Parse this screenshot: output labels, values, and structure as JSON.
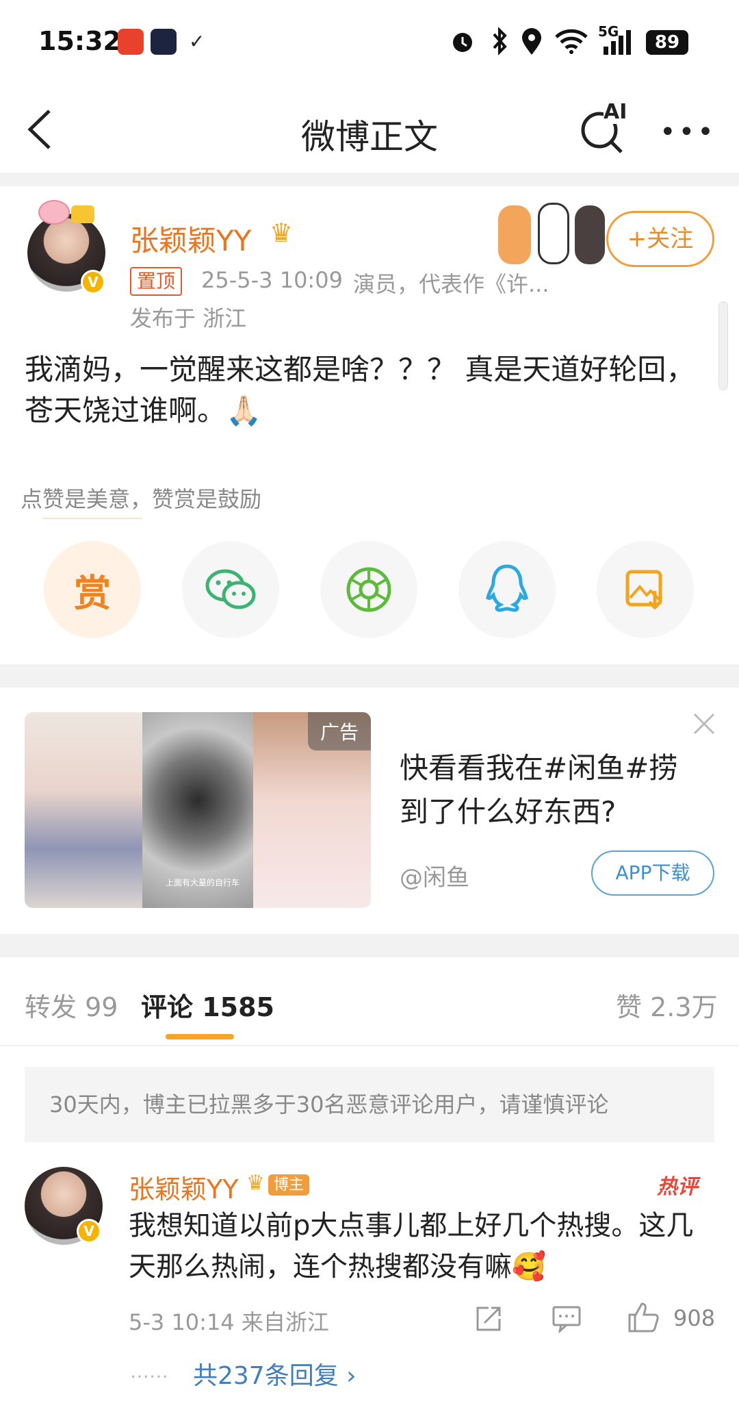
{
  "status_bar": {
    "time": "15:32",
    "signal": "5G",
    "battery": "89"
  },
  "nav": {
    "title": "微博正文",
    "ai_label": "AI"
  },
  "post": {
    "author": "张颖颖YY",
    "pin_label": "置顶",
    "date": "25-5-3 10:09",
    "bio": "演员，代表作《许...",
    "location": "发布于 浙江",
    "follow_label": "+关注",
    "text": "我滴妈，一觉醒来这都是啥？？？ 真是天道好轮回，苍天饶过谁啊。🙏🏻",
    "reward_tip": "点赞是美意，赞赏是鼓励",
    "reward_label": "赏"
  },
  "ad": {
    "tag": "广告",
    "caption": "上面有大量的自行车",
    "text": "快看看我在#闲鱼#捞到了什么好东西?",
    "source": "@闲鱼",
    "button": "APP下载"
  },
  "tabs": {
    "repost": "转发 99",
    "comment": "评论 1585",
    "like": "赞 2.3万"
  },
  "notice": "30天内，博主已拉黑多于30名恶意评论用户，请谨慎评论",
  "comment": {
    "author": "张颖颖YY",
    "badge": "博主",
    "hot_label": "热评",
    "text": "我想知道以前p大点事儿都上好几个热搜。这几天那么热闹，连个热搜都没有嘛🥰",
    "meta": "5-3 10:14  来自浙江",
    "likes": "908",
    "replies": "共237条回复 ›",
    "dots": "……"
  }
}
